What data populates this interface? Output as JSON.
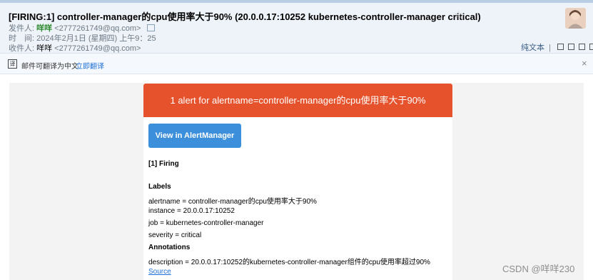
{
  "email": {
    "subject": "[FIRING:1] controller-manager的cpu使用率大于90% (20.0.0.17:10252 kubernetes-controller-manager critical)",
    "sender_label": "发件人:",
    "sender_name": "咩咩",
    "sender_email": "<2777261749@qq.com>",
    "time_label": "时　间:",
    "time_value": "2024年2月1日 (星期四) 上午9：25",
    "recipient_label": "收件人:",
    "recipient_name": "咩咩",
    "recipient_email": "<2777261749@qq.com>",
    "plain_text_label": "纯文本"
  },
  "translate_bar": {
    "message": "邮件可翻译为中文",
    "action": "立即翻译",
    "close": "×"
  },
  "alert": {
    "banner": "1 alert for alertname=controller-manager的cpu使用率大于90%",
    "button": "View in AlertManager",
    "firing_heading": "[1] Firing",
    "labels_heading": "Labels",
    "labels": [
      "alertname = controller-manager的cpu使用率大于90%",
      "instance = 20.0.0.17:10252",
      "job = kubernetes-controller-manager",
      "severity = critical"
    ],
    "annotations_heading": "Annotations",
    "annotations": [
      "description = 20.0.0.17:10252的kubernetes-controller-manager组件的cpu使用率超过90%"
    ],
    "source_link": "Source"
  },
  "watermark": "CSDN @咩咩230",
  "colors": {
    "banner": "#e6522c",
    "button": "#3b8fdb",
    "link": "#1e6fd9",
    "header_bg": "#eef3fa"
  }
}
